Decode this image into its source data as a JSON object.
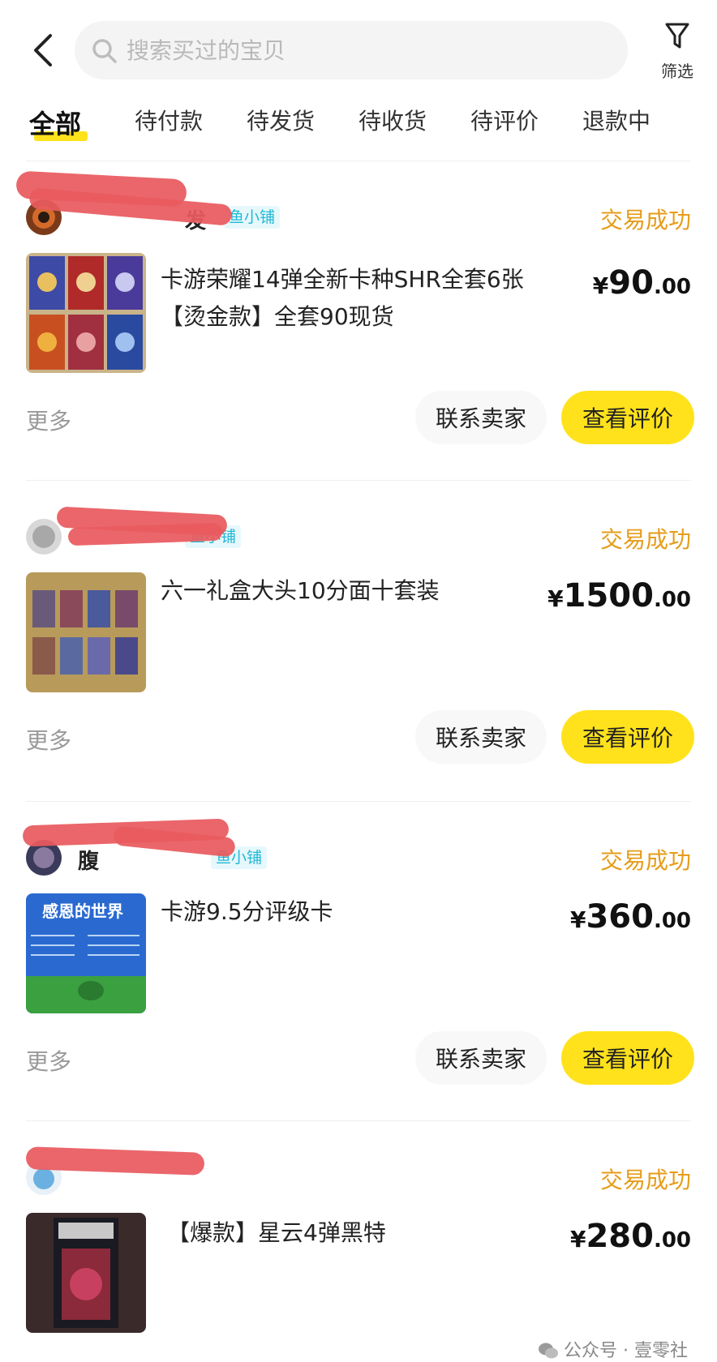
{
  "search": {
    "placeholder": "搜索买过的宝贝"
  },
  "filter": {
    "label": "筛选"
  },
  "tabs": [
    {
      "label": "全部",
      "active": true
    },
    {
      "label": "待付款"
    },
    {
      "label": "待发货"
    },
    {
      "label": "待收货"
    },
    {
      "label": "待评价"
    },
    {
      "label": "退款中"
    }
  ],
  "orders": [
    {
      "seller_suffix": "发",
      "shop_badge": "鱼小铺",
      "status": "交易成功",
      "title": "卡游荣耀14弹全新卡种SHR全套6张【烫金款】全套90现货",
      "price_currency": "¥",
      "price_int": "90",
      "price_dec": ".00",
      "more": "更多",
      "contact": "联系卖家",
      "review": "查看评价"
    },
    {
      "seller_suffix": "",
      "shop_badge": "鱼小铺",
      "status": "交易成功",
      "title": "六一礼盒大头10分面十套装",
      "price_currency": "¥",
      "price_int": "1500",
      "price_dec": ".00",
      "more": "更多",
      "contact": "联系卖家",
      "review": "查看评价"
    },
    {
      "seller_suffix": "腹",
      "shop_badge": "鱼小铺",
      "status": "交易成功",
      "title": "卡游9.5分评级卡",
      "thumb_text": "感恩的世界",
      "price_currency": "¥",
      "price_int": "360",
      "price_dec": ".00",
      "more": "更多",
      "contact": "联系卖家",
      "review": "查看评价"
    },
    {
      "seller_suffix": "",
      "shop_badge": "",
      "status": "交易成功",
      "title": "【爆款】星云4弹黑特",
      "price_currency": "¥",
      "price_int": "280",
      "price_dec": ".00"
    }
  ],
  "watermark": "公众号 · 壹零社",
  "colors": {
    "accent": "#ffe21b",
    "status": "#e69c19",
    "badge": "#22b8d6"
  }
}
